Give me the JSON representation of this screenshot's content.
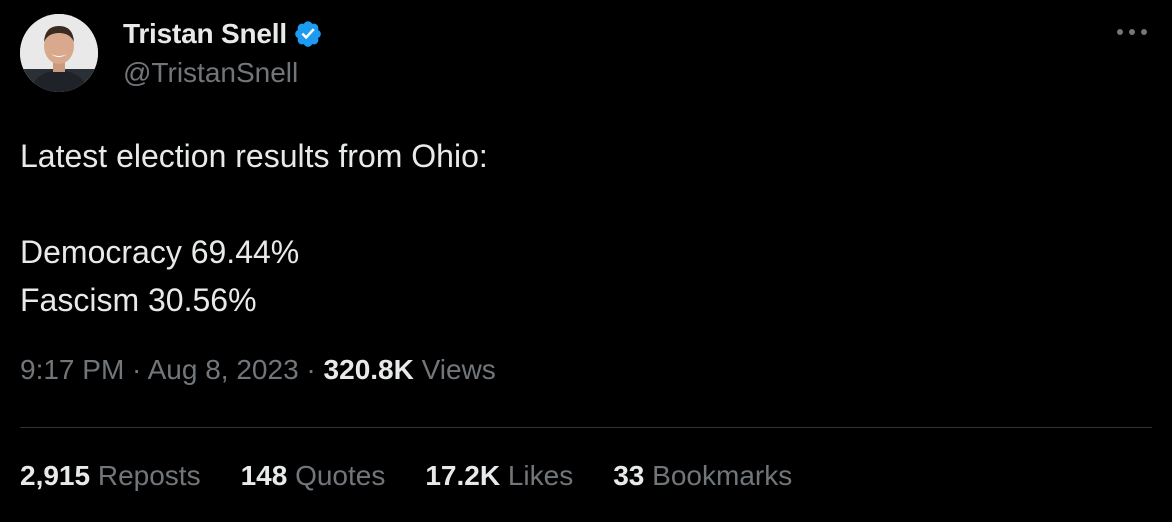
{
  "author": {
    "display_name": "Tristan Snell",
    "handle": "@TristanSnell",
    "verified": true,
    "verified_color": "#1d9bf0"
  },
  "tweet": {
    "lines": [
      "Latest election results from Ohio:",
      "",
      "Democracy 69.44%",
      "Fascism 30.56%"
    ]
  },
  "meta": {
    "time": "9:17 PM",
    "separator": " · ",
    "date": "Aug 8, 2023",
    "views_count": "320.8K",
    "views_label": "Views"
  },
  "stats": {
    "reposts": {
      "count": "2,915",
      "label": "Reposts"
    },
    "quotes": {
      "count": "148",
      "label": "Quotes"
    },
    "likes": {
      "count": "17.2K",
      "label": "Likes"
    },
    "bookmarks": {
      "count": "33",
      "label": "Bookmarks"
    }
  },
  "icons": {
    "more": "more-horizontal-icon",
    "verified": "verified-badge-icon"
  },
  "colors": {
    "background": "#000000",
    "text_primary": "#e7e9ea",
    "text_secondary": "#71767b",
    "divider": "#2f3336"
  }
}
